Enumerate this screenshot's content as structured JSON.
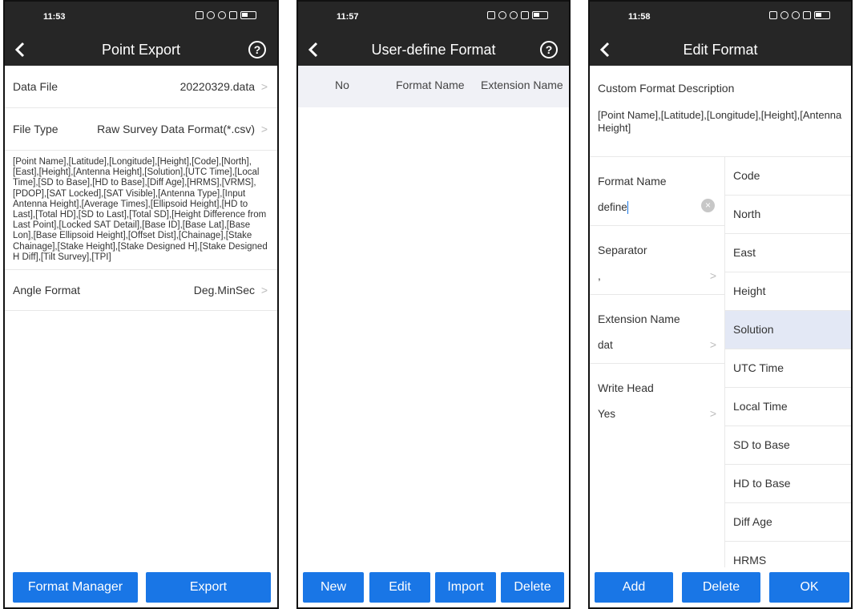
{
  "screen1": {
    "status_time": "11:53",
    "title": "Point Export",
    "rows": [
      {
        "label": "Data File",
        "value": "20220329.data"
      },
      {
        "label": "File Type",
        "value": "Raw Survey Data Format(*.csv)"
      }
    ],
    "field_list": "[Point Name],[Latitude],[Longitude],[Height],[Code],[North],[East],[Height],[Antenna Height],[Solution],[UTC Time],[Local Time],[SD to Base],[HD to Base],[Diff Age],[HRMS],[VRMS],[PDOP],[SAT Locked],[SAT Visible],[Antenna Type],[Input Antenna Height],[Average Times],[Ellipsoid Height],[HD to Last],[Total HD],[SD to Last],[Total SD],[Height Difference from Last Point],[Locked SAT Detail],[Base ID],[Base Lat],[Base Lon],[Base Ellipsoid Height],[Offset Dist],[Chainage],[Stake Chainage],[Stake Height],[Stake Designed H],[Stake Designed H Diff],[Tilt Survey],[TPI]",
    "angle_row": {
      "label": "Angle Format",
      "value": "Deg.MinSec"
    },
    "buttons": {
      "format_manager": "Format Manager",
      "export": "Export"
    }
  },
  "screen2": {
    "status_time": "11:57",
    "title": "User-define Format",
    "columns": [
      "No",
      "Format Name",
      "Extension Name"
    ],
    "buttons": {
      "new": "New",
      "edit": "Edit",
      "import": "Import",
      "delete": "Delete"
    }
  },
  "screen3": {
    "status_time": "11:58",
    "title": "Edit Format",
    "desc_label": "Custom Format Description",
    "desc_value": "[Point Name],[Latitude],[Longitude],[Height],[Antenna Height]",
    "format_name_label": "Format Name",
    "format_name_value": "define",
    "separator_label": "Separator",
    "separator_value": ",",
    "extension_label": "Extension Name",
    "extension_value": "dat",
    "write_head_label": "Write Head",
    "write_head_value": "Yes",
    "fields": [
      "Code",
      "North",
      "East",
      "Height",
      "Solution",
      "UTC Time",
      "Local Time",
      "SD to Base",
      "HD to Base",
      "Diff Age",
      "HRMS"
    ],
    "selected_field": "Solution",
    "buttons": {
      "add": "Add",
      "delete": "Delete",
      "ok": "OK"
    }
  },
  "colors": {
    "header": "#262626",
    "button": "#1976e6",
    "selected_row": "#e3e8f5"
  }
}
